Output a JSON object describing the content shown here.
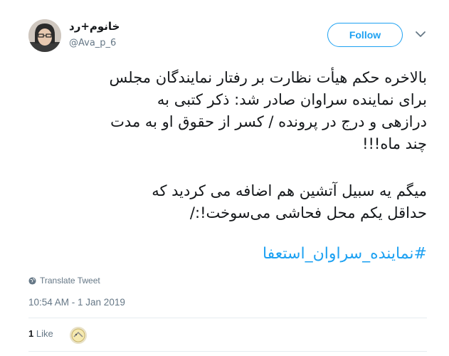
{
  "author": {
    "display_name": "خانوم+رد",
    "handle": "@Ava_p_6"
  },
  "follow_label": "Follow",
  "tweet": {
    "paragraph1": [
      "بالاخره حکم هیأت نظارت بر رفتار نمایندگان مجلس",
      "برای نماینده سراوان صادر شد: ذکر کتبی به",
      "درازهی و درج در پرونده / کسر از حقوق او به مدت",
      "چند ماه!!!"
    ],
    "paragraph2": [
      "میگم یه سبیل آتشین هم اضافه می کردید که",
      "حداقل یکم محل فحاشی می‌سوخت!:/"
    ],
    "hashtag": "#نماینده_سراوان_استعفا"
  },
  "translate_label": "Translate Tweet",
  "timestamp": "10:54 AM - 1 Jan 2019",
  "likes": {
    "count": "1",
    "label": "Like"
  },
  "colors": {
    "accent": "#1da1f2",
    "text": "#14171a",
    "muted": "#657786"
  },
  "icons": [
    "globe-icon",
    "chevron-down-icon"
  ]
}
